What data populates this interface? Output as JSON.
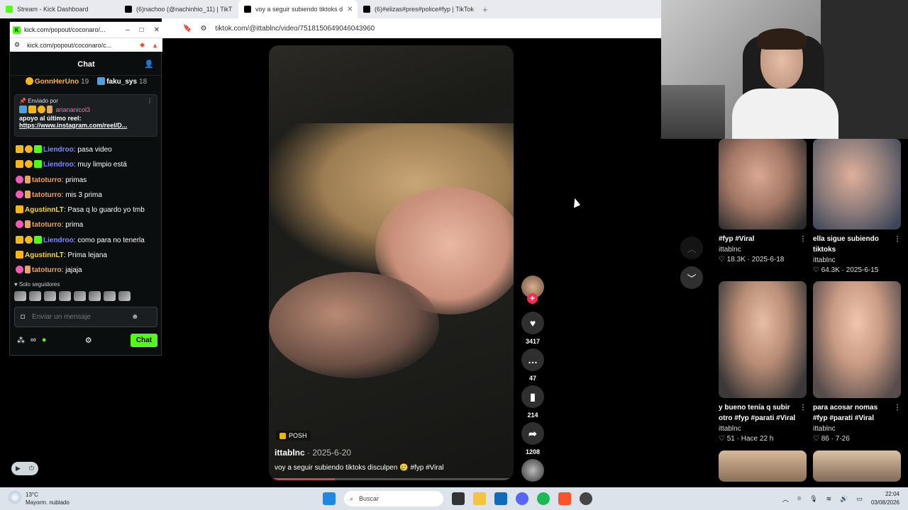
{
  "browser": {
    "tabs": [
      {
        "label": "Stream - Kick Dashboard",
        "color": "#53fc18"
      },
      {
        "label": "(6)nachoo (@nachinhio_11) | TikT",
        "color": "#000000"
      },
      {
        "label": "voy a seguir subiendo tiktoks d",
        "color": "#000000"
      },
      {
        "label": "(6)#elizas#pres#police#fyp | TikTok",
        "color": "#000000"
      }
    ],
    "url": "tiktok.com/@ittablnc/video/7518150649046043960"
  },
  "chat_window": {
    "title": "kick.com/popout/coconaro/...",
    "url": "kick.com/popout/coconaro/c...",
    "header": "Chat",
    "top_users": [
      {
        "name": "GonnHerUno",
        "count": "19"
      },
      {
        "name": "faku_sys",
        "count": "18"
      }
    ],
    "pinned": {
      "label": "Enviado por",
      "user": "ariananicol3",
      "message": "apoyo al último reel:",
      "link": "https://www.instagram.com/reel/D..."
    },
    "messages": [
      {
        "user": "Liendroo",
        "text": ": pasa video",
        "style": "liendroo"
      },
      {
        "user": "Liendroo",
        "text": ": muy limpio está",
        "style": "liendroo"
      },
      {
        "user": "tatoturro",
        "text": ": primas",
        "style": "tatoturro"
      },
      {
        "user": "tatoturro",
        "text": ": mis 3 prima",
        "style": "tatoturro"
      },
      {
        "user": "AgustinnLT",
        "text": ": Pasa q lo guardo yo tmb",
        "style": "agustin"
      },
      {
        "user": "tatoturro",
        "text": ": prima",
        "style": "tatoturro"
      },
      {
        "user": "Liendroo",
        "text": ": como para no tenerla",
        "style": "liendroo"
      },
      {
        "user": "AgustinnLT",
        "text": ": Prima lejana",
        "style": "agustin"
      },
      {
        "user": "tatoturro",
        "text": ": jajaja",
        "style": "tatoturro"
      }
    ],
    "followers_only": "Solo seguidores",
    "input_placeholder": "Enviar un mensaje",
    "send_label": "Chat"
  },
  "video": {
    "tag": "POSH",
    "author": "ittablnc",
    "date": "· 2025-6-20",
    "description": "voy a seguir subiendo tiktoks disculpen 🥲 #fyp #Viral",
    "progress": 0.27,
    "likes": "3417",
    "comments": "47",
    "saves": "214",
    "shares": "1208"
  },
  "recommendations": [
    {
      "title": "#fyp #Viral",
      "author": "ittablnc",
      "meta": "♡ 18.3K · 2025-6-18"
    },
    {
      "title": "ella sigue subiendo tiktoks",
      "author": "ittablnc",
      "meta": "♡ 64.3K · 2025-6-15"
    },
    {
      "title": "y bueno tenía q subir otro #fyp #parati #Viral",
      "author": "ittablnc",
      "meta": "♡ 51 · Hace 22 h"
    },
    {
      "title": "para acosar nomas #fyp #parati #Viral",
      "author": "ittablnc",
      "meta": "♡ 86 · 7-26"
    }
  ],
  "taskbar": {
    "temp": "13°C",
    "weather": "Mayorm. nublado",
    "search": "Buscar",
    "time": "22:04",
    "date": "03/08/2026"
  },
  "colors": {
    "kick_green": "#53fc18",
    "tiktok_red": "#fe2c55"
  }
}
